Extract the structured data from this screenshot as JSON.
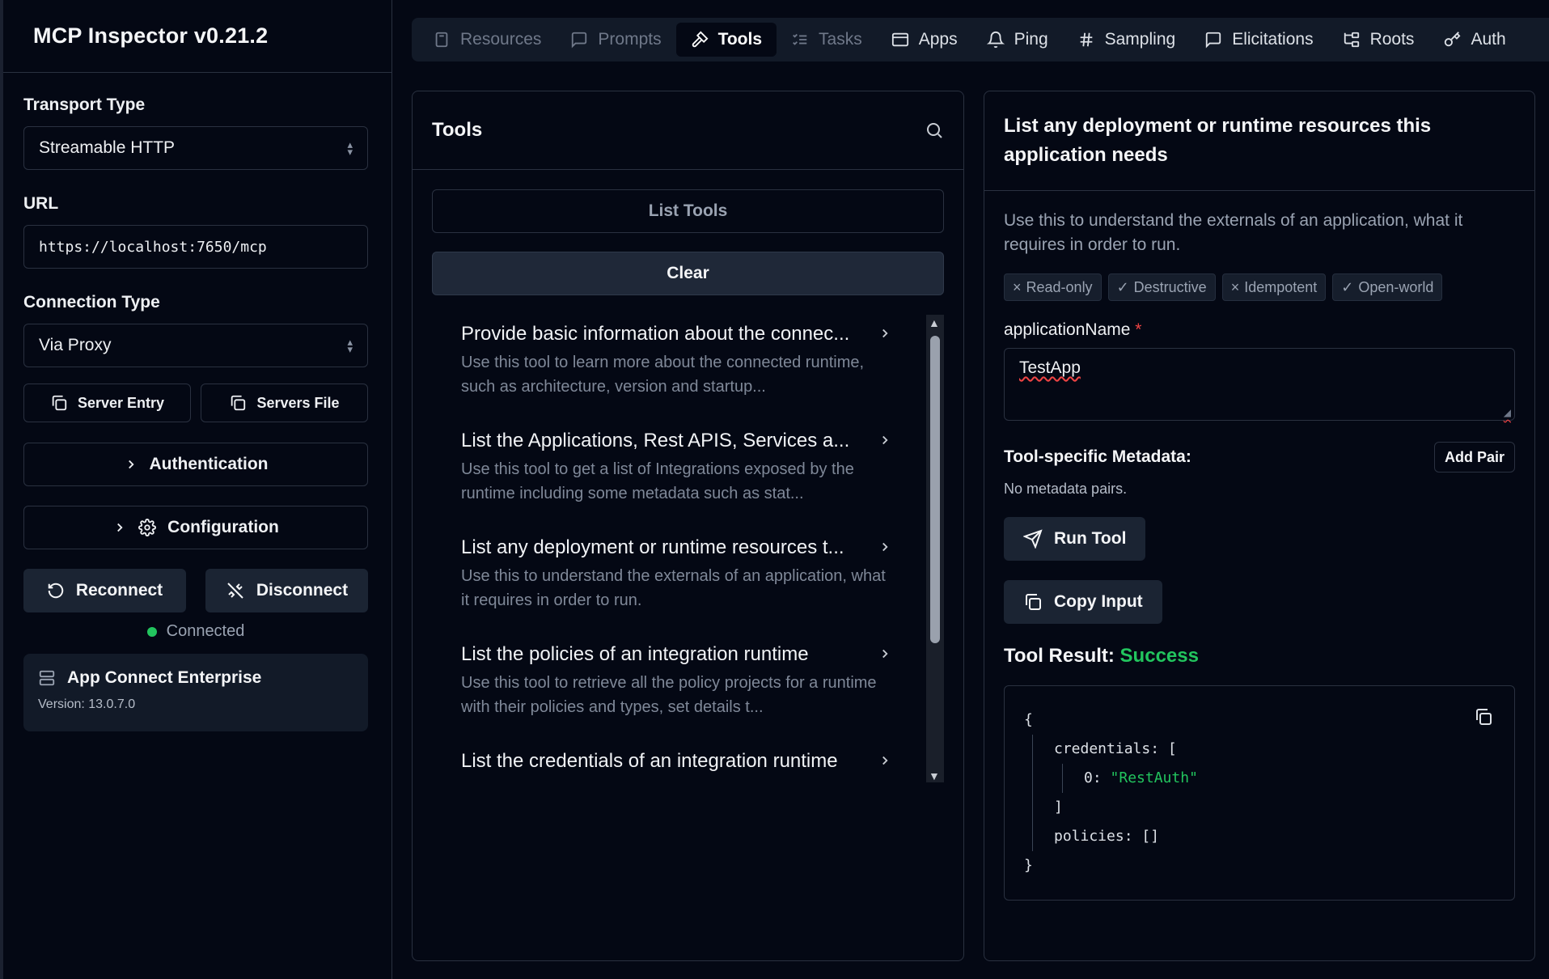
{
  "app": {
    "title": "MCP Inspector v0.21.2"
  },
  "sidebar": {
    "transport_label": "Transport Type",
    "transport_value": "Streamable HTTP",
    "url_label": "URL",
    "url_value": "https://localhost:7650/mcp",
    "connection_label": "Connection Type",
    "connection_value": "Via Proxy",
    "server_entry_label": "Server Entry",
    "servers_file_label": "Servers File",
    "authentication_label": "Authentication",
    "configuration_label": "Configuration",
    "reconnect_label": "Reconnect",
    "disconnect_label": "Disconnect",
    "status_text": "Connected",
    "status_color": "#22c55e",
    "server_name": "App Connect Enterprise",
    "server_version": "Version: 13.0.7.0"
  },
  "tabs": [
    {
      "label": "Resources",
      "icon": "file-icon",
      "state": "disabled"
    },
    {
      "label": "Prompts",
      "icon": "message-icon",
      "state": "disabled"
    },
    {
      "label": "Tools",
      "icon": "hammer-icon",
      "state": "active"
    },
    {
      "label": "Tasks",
      "icon": "list-checks-icon",
      "state": "disabled"
    },
    {
      "label": "Apps",
      "icon": "app-window-icon",
      "state": "enabled"
    },
    {
      "label": "Ping",
      "icon": "bell-icon",
      "state": "enabled"
    },
    {
      "label": "Sampling",
      "icon": "hash-icon",
      "state": "enabled"
    },
    {
      "label": "Elicitations",
      "icon": "message-icon",
      "state": "enabled"
    },
    {
      "label": "Roots",
      "icon": "folder-tree-icon",
      "state": "enabled"
    },
    {
      "label": "Auth",
      "icon": "key-icon",
      "state": "enabled"
    }
  ],
  "tools_panel": {
    "title": "Tools",
    "list_button": "List Tools",
    "clear_button": "Clear",
    "items": [
      {
        "title": "Provide basic information about the connec...",
        "desc": "Use this tool to learn more about the connected runtime, such as architecture, version and startup..."
      },
      {
        "title": "List the Applications, Rest APIS, Services a...",
        "desc": "Use this tool to get a list of Integrations exposed by the runtime including some metadata such as stat..."
      },
      {
        "title": "List any deployment or runtime resources t...",
        "desc": "Use this to understand the externals of an application, what it requires in order to run."
      },
      {
        "title": "List the policies of an integration runtime",
        "desc": "Use this tool to retrieve all the policy projects for a runtime with their policies and types, set details t..."
      },
      {
        "title": "List the credentials of an integration runtime",
        "desc": ""
      }
    ]
  },
  "detail": {
    "title": "List any deployment or runtime resources this application needs",
    "description": "Use this to understand the externals of an application, what it requires in order to run.",
    "hints": [
      {
        "symbol": "×",
        "label": "Read-only"
      },
      {
        "symbol": "✓",
        "label": "Destructive"
      },
      {
        "symbol": "×",
        "label": "Idempotent"
      },
      {
        "symbol": "✓",
        "label": "Open-world"
      }
    ],
    "arg_name": "applicationName",
    "arg_required_mark": "*",
    "arg_value": "TestApp",
    "metadata_label": "Tool-specific Metadata:",
    "add_pair_label": "Add Pair",
    "no_metadata_text": "No metadata pairs.",
    "run_tool_label": "Run Tool",
    "copy_input_label": "Copy Input",
    "result_label": "Tool Result:",
    "result_status": "Success",
    "result_status_color": "#22c55e",
    "json": {
      "open_brace": "{",
      "credentials_key": "credentials:",
      "open_bracket": "[",
      "index_key": "0:",
      "credential_value": "\"RestAuth\"",
      "close_bracket": "]",
      "policies_key": "policies:",
      "policies_value": "[]",
      "close_brace": "}"
    }
  }
}
